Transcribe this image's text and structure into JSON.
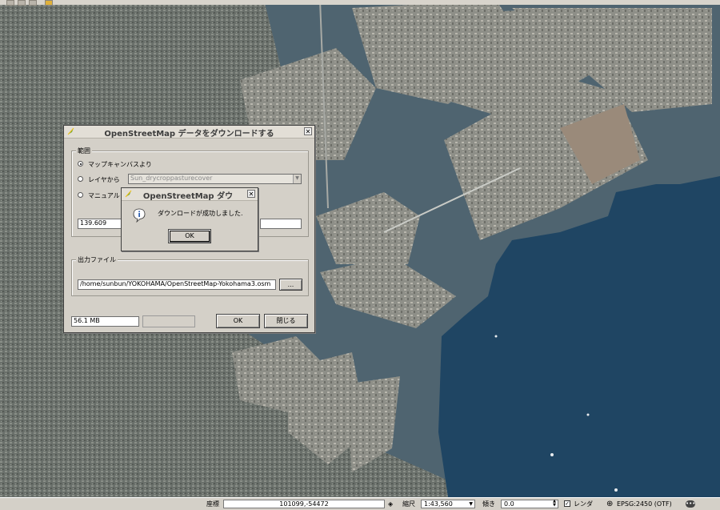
{
  "map": {
    "description_colors": {
      "sea": "#1f3f5c",
      "land": "#7d8a82",
      "urban": "#6b6f68"
    }
  },
  "main_dialog": {
    "title": "OpenStreetMap データをダウンロードする",
    "extent_group_label": "範囲",
    "radio_canvas_label": "マップキャンバスより",
    "radio_layer_label": "レイヤから",
    "layer_combo_value": "Sun_drycroppasturecover",
    "radio_manual_label": "マニュアル",
    "coord_field_value": "139.609",
    "output_group_label": "出力ファイル",
    "output_path_value": "/home/sunbun/YOKOHAMA/OpenStreetMap-Yokohama3.osm",
    "browse_button_label": "...",
    "download_size": "56.1 MB",
    "ok_button_label": "OK",
    "close_button_label": "閉じる"
  },
  "message_box": {
    "title": "OpenStreetMap ダウ",
    "message": "ダウンロードが成功しました.",
    "ok_button_label": "OK"
  },
  "statusbar": {
    "coord_label": "座標",
    "coord_value": "101099,-54472",
    "scale_label": "縮尺",
    "scale_value": "1:43,560",
    "rotation_label": "傾き",
    "rotation_value": "0.0",
    "render_label": "レンダ",
    "crs_label": "EPSG:2450 (OTF)"
  }
}
